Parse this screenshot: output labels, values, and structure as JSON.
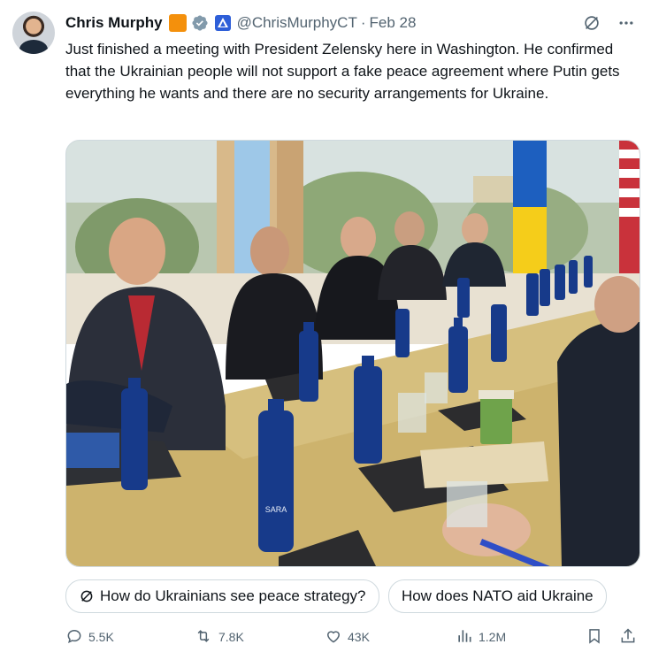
{
  "author": {
    "name": "Chris Murphy",
    "handle": "@ChrisMurphyCT",
    "separator": "·",
    "date": "Feb 28"
  },
  "tweet": {
    "text": "Just finished a meeting with President Zelensky here in Washington. He confirmed that the Ukrainian people will not support a fake peace agreement where Putin gets everything he wants and there are no security arrangements for Ukraine."
  },
  "media": {
    "alt_icon": "photo-meeting-table",
    "bottle_label": "SARA"
  },
  "grok_chips": [
    {
      "label": "How do Ukrainians see peace strategy?"
    },
    {
      "label": "How does NATO aid Ukraine"
    }
  ],
  "actions": {
    "replies": "5.5K",
    "reposts": "7.8K",
    "likes": "43K",
    "views": "1.2M"
  },
  "colors": {
    "text": "#0f1419",
    "secondary": "#536471",
    "verified": "#829aab",
    "org_badge": "#f4900c",
    "border": "#cfd9de"
  }
}
